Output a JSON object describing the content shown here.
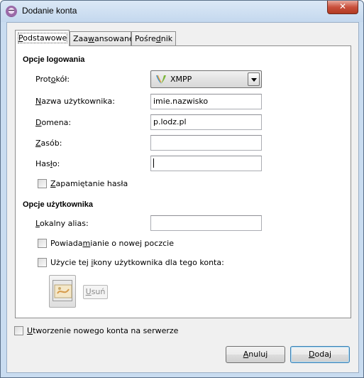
{
  "window": {
    "title": "Dodanie konta",
    "close_glyph": "✕"
  },
  "tabs": [
    {
      "pre": "",
      "u": "P",
      "post": "odstawowe"
    },
    {
      "pre": "Zaa",
      "u": "w",
      "post": "ansowane"
    },
    {
      "pre": "Pośre",
      "u": "d",
      "post": "nik"
    }
  ],
  "login": {
    "section": "Opcje logowania",
    "protocol": {
      "pre": "Prot",
      "u": "o",
      "post": "kół:",
      "value": "XMPP",
      "icon": "xmpp-icon"
    },
    "username": {
      "pre": "",
      "u": "N",
      "post": "azwa użytkownika:",
      "value": "imie.nazwisko"
    },
    "domain": {
      "pre": "",
      "u": "D",
      "post": "omena:",
      "value": "p.lodz.pl"
    },
    "resource": {
      "pre": "",
      "u": "Z",
      "post": "asób:",
      "value": ""
    },
    "password": {
      "pre": "Has",
      "u": "ł",
      "post": "o:",
      "value": ""
    },
    "remember": {
      "pre": "",
      "u": "Z",
      "post": "apamiętanie hasła",
      "checked": false
    }
  },
  "user": {
    "section": "Opcje użytkownika",
    "alias": {
      "pre": "",
      "u": "L",
      "post": "okalny alias:",
      "value": ""
    },
    "new_mail": {
      "pre": "Powiada",
      "u": "m",
      "post": "ianie o nowej poczcie",
      "checked": false
    },
    "use_icon": {
      "pre": "Użycie tej ",
      "u": "i",
      "post": "kony użytkownika dla tego konta:",
      "checked": false
    },
    "remove_btn": {
      "pre": "",
      "u": "U",
      "post": "suń"
    }
  },
  "create_account": {
    "pre": "",
    "u": "U",
    "post": "tworzenie nowego konta na serwerze",
    "checked": false
  },
  "buttons": {
    "cancel": {
      "pre": "",
      "u": "A",
      "post": "nuluj"
    },
    "add": {
      "pre": "",
      "u": "D",
      "post": "odaj"
    }
  }
}
